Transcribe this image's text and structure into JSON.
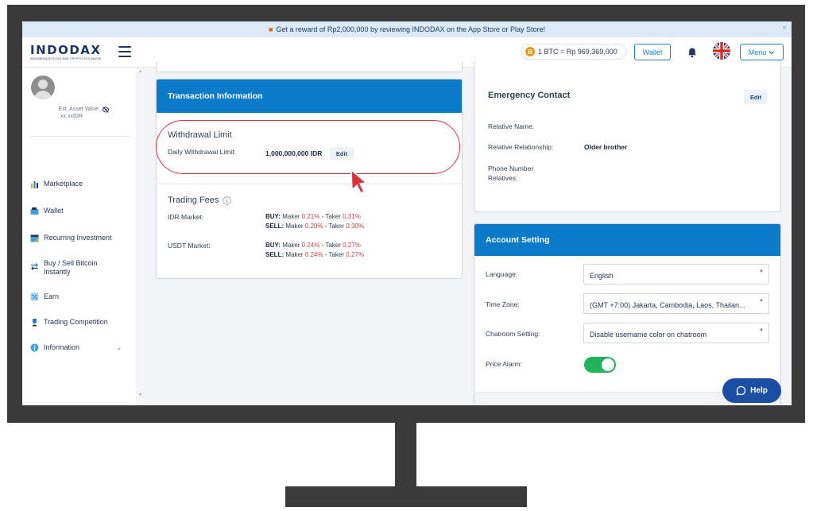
{
  "promo": {
    "text": "Get a reward of Rp2,000,000 by reviewing INDODAX on the App Store or Play Store!",
    "close": "×"
  },
  "header": {
    "logo": "INDODAX",
    "logo_tagline": "INDONESIA BITCOIN AND CRYPTO EXCHANGE",
    "btc_coin_symbol": "B",
    "btc_price": "1 BTC = Rp 969,369,000",
    "wallet_label": "Wallet",
    "menu_label": "Menu"
  },
  "sidebar": {
    "asset_label": "Est. Asset Value",
    "asset_value": "xx.xxIDR",
    "items": [
      {
        "label": "Marketplace",
        "icon": "chart-bar-icon"
      },
      {
        "label": "Wallet",
        "icon": "wallet-icon"
      },
      {
        "label": "Recurring Investment",
        "icon": "calendar-icon"
      },
      {
        "label": "Buy / Sell Bitcoin Instantly",
        "icon": "swap-icon"
      },
      {
        "label": "Earn",
        "icon": "percent-icon"
      },
      {
        "label": "Trading Competition",
        "icon": "trophy-icon"
      },
      {
        "label": "Information",
        "icon": "info-icon"
      }
    ]
  },
  "transaction": {
    "title": "Transaction Information",
    "withdrawal_title": "Withdrawal Limit",
    "daily_label": "Daily Withdrawal Limit:",
    "daily_value": "1,000,000,000 IDR",
    "edit_label": "Edit",
    "fees_title": "Trading Fees",
    "idr_label": "IDR Market:",
    "usdt_label": "USDT Market:",
    "buy": "BUY:",
    "sell": "SELL:",
    "maker": "Maker",
    "taker": "Taker",
    "idr_buy_maker": "0.21%",
    "idr_buy_taker": "0.31%",
    "idr_sell_maker": "0.20%",
    "idr_sell_taker": "0.30%",
    "usdt_buy_maker": "0.24%",
    "usdt_buy_taker": "0.27%",
    "usdt_sell_maker": "0.24%",
    "usdt_sell_taker": "0.27%"
  },
  "emergency": {
    "title": "Emergency Contact",
    "edit_label": "Edit",
    "relative_name_label": "Relative Name:",
    "relationship_label": "Relative Relationship:",
    "relationship_value": "Older brother",
    "phone_label": "Phone Number Relatives:"
  },
  "account": {
    "title": "Account Setting",
    "language_label": "Language:",
    "language_value": "English",
    "timezone_label": "Time Zone:",
    "timezone_value": "(GMT +7:00) Jakarta, Cambodia, Laos, Thailan...",
    "chatroom_label": "Chatroom Setting:",
    "chatroom_value": "Disable username color on chatroom",
    "price_alarm_label": "Price Alarm:",
    "price_alarm_on": true
  },
  "help_label": "Help",
  "colors": {
    "brand_blue": "#0b7bc9",
    "navy": "#1e3462",
    "highlight_red": "#e0303a",
    "toggle_green": "#1fb35a",
    "help_blue": "#1a4fa3"
  }
}
